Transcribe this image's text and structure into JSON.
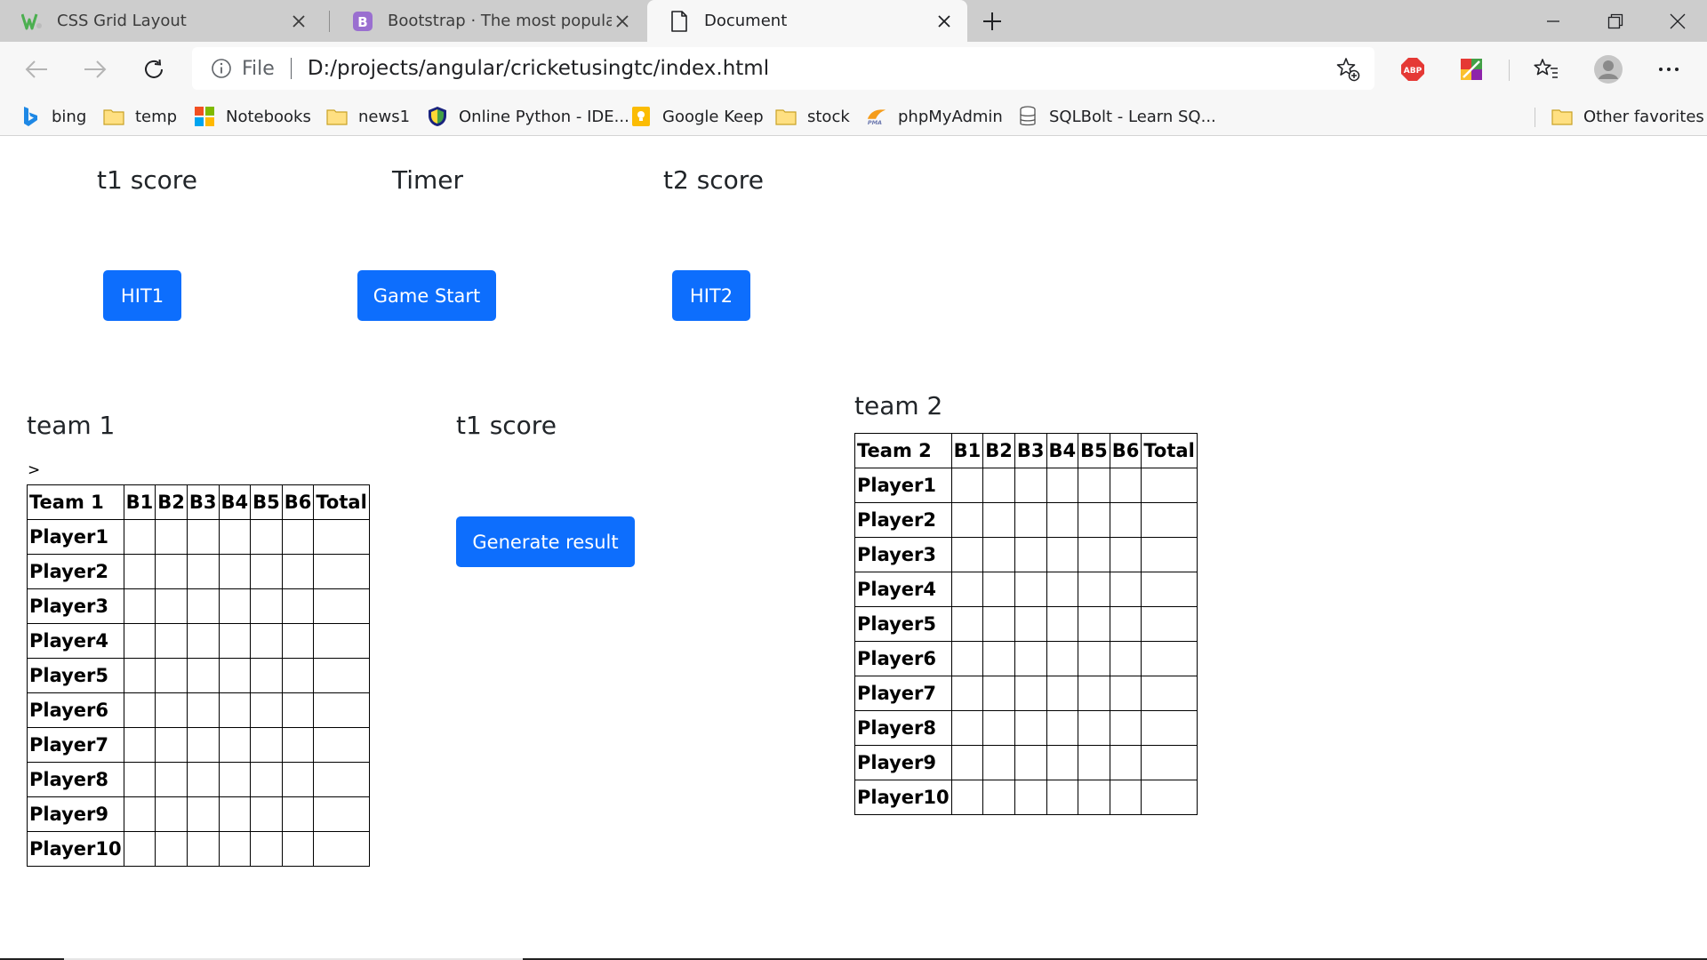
{
  "browser": {
    "tabs": [
      {
        "title": "CSS Grid Layout",
        "icon": "w3schools-icon"
      },
      {
        "title": "Bootstrap · The most popular HT",
        "icon": "bootstrap-icon"
      },
      {
        "title": "Document",
        "icon": "page-icon"
      }
    ],
    "address": {
      "scheme_label": "File",
      "url": "D:/projects/angular/cricketusingtc/index.html"
    },
    "bookmarks": [
      {
        "label": "bing",
        "icon": "bing-icon"
      },
      {
        "label": "temp",
        "icon": "folder-icon"
      },
      {
        "label": "Notebooks",
        "icon": "microsoft-icon"
      },
      {
        "label": "news1",
        "icon": "folder-icon"
      },
      {
        "label": "Online Python - IDE...",
        "icon": "shield-icon"
      },
      {
        "label": "Google Keep",
        "icon": "keep-icon"
      },
      {
        "label": "stock",
        "icon": "folder-icon"
      },
      {
        "label": "phpMyAdmin",
        "icon": "phpmyadmin-icon"
      },
      {
        "label": "SQLBolt - Learn SQ...",
        "icon": "database-icon"
      }
    ],
    "other_favorites": "Other favorites",
    "colors": {
      "tab_strip": "#cdcdcd",
      "toolbar": "#f7f7f7",
      "accent_button": "#0d6efd"
    }
  },
  "page": {
    "t1_score_label": "t1 score",
    "timer_label": "Timer",
    "t2_score_label": "t2 score",
    "hit1_label": "HIT1",
    "game_start_label": "Game Start",
    "hit2_label": "HIT2",
    "team1_heading": "team 1",
    "team1_caret": ">",
    "middle_score_label": "t1 score",
    "generate_label": "Generate result",
    "team2_heading": "team 2",
    "team1_table": {
      "headers": [
        "Team 1",
        "B1",
        "B2",
        "B3",
        "B4",
        "B5",
        "B6",
        "Total"
      ],
      "rows": [
        "Player1",
        "Player2",
        "Player3",
        "Player4",
        "Player5",
        "Player6",
        "Player7",
        "Player8",
        "Player9",
        "Player10"
      ]
    },
    "team2_table": {
      "headers": [
        "Team 2",
        "B1",
        "B2",
        "B3",
        "B4",
        "B5",
        "B6",
        "Total"
      ],
      "rows": [
        "Player1",
        "Player2",
        "Player3",
        "Player4",
        "Player5",
        "Player6",
        "Player7",
        "Player8",
        "Player9",
        "Player10"
      ]
    }
  }
}
